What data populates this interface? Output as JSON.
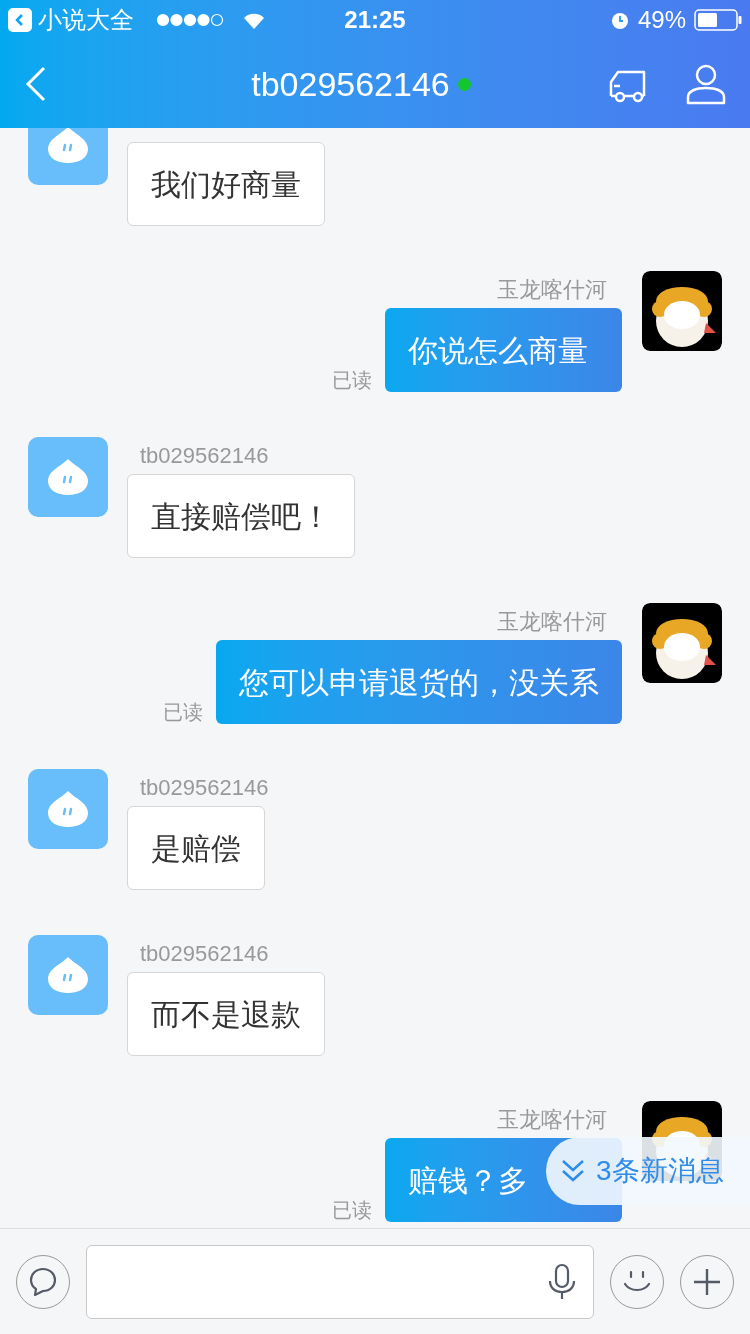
{
  "status_bar": {
    "back_app": "小说大全",
    "time": "21:25",
    "battery": "49%"
  },
  "header": {
    "title": "tb029562146",
    "online": true
  },
  "messages": [
    {
      "kind": "incoming",
      "text": "我们好商量"
    },
    {
      "kind": "outgoing",
      "sender": "玉龙喀什河",
      "text": "你说怎么商量",
      "receipt": "已读"
    },
    {
      "kind": "incoming",
      "sender": "tb029562146",
      "text": "直接赔偿吧！"
    },
    {
      "kind": "outgoing",
      "sender": "玉龙喀什河",
      "text": "您可以申请退货的，没关系",
      "receipt": "已读"
    },
    {
      "kind": "incoming",
      "sender": "tb029562146",
      "text": "是赔偿"
    },
    {
      "kind": "incoming",
      "sender": "tb029562146",
      "text": "而不是退款"
    },
    {
      "kind": "outgoing",
      "sender": "玉龙喀什河",
      "text": "赔钱？多",
      "receipt": "已读"
    }
  ],
  "new_messages": {
    "label": "3条新消息"
  }
}
